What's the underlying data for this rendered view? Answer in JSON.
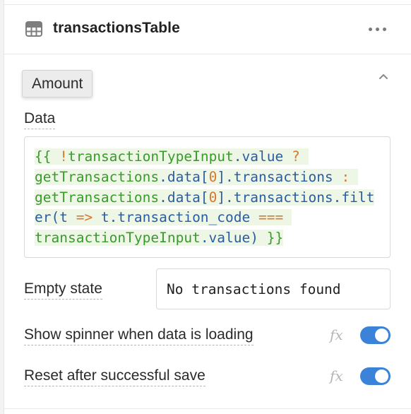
{
  "component": {
    "name": "transactionsTable",
    "icon": "table-icon",
    "menu_icon": "more-horizontal-icon"
  },
  "tooltip": {
    "text": "Amount"
  },
  "section": {
    "collapse_icon": "chevron-up-icon"
  },
  "data_field": {
    "label": "Data",
    "code_lines": [
      "{{ !transactionTypeInput.value ?",
      "getTransactions.data[0].transactions :",
      "getTransactions.data[0].transactions.filt",
      "er(t => t.transaction_code ===",
      "transactionTypeInput.value) }}"
    ]
  },
  "empty_state": {
    "label": "Empty state",
    "value": "No transactions found"
  },
  "toggles": {
    "spinner": {
      "label": "Show spinner when data is loading",
      "enabled": true
    },
    "reset": {
      "label": "Reset after successful save",
      "enabled": true
    },
    "fx_label": "fx"
  },
  "colors": {
    "toggle_on": "#3b82d9",
    "code_green": "#3a9a2d",
    "code_blue": "#2b5ca0",
    "code_orange": "#d7782f"
  }
}
